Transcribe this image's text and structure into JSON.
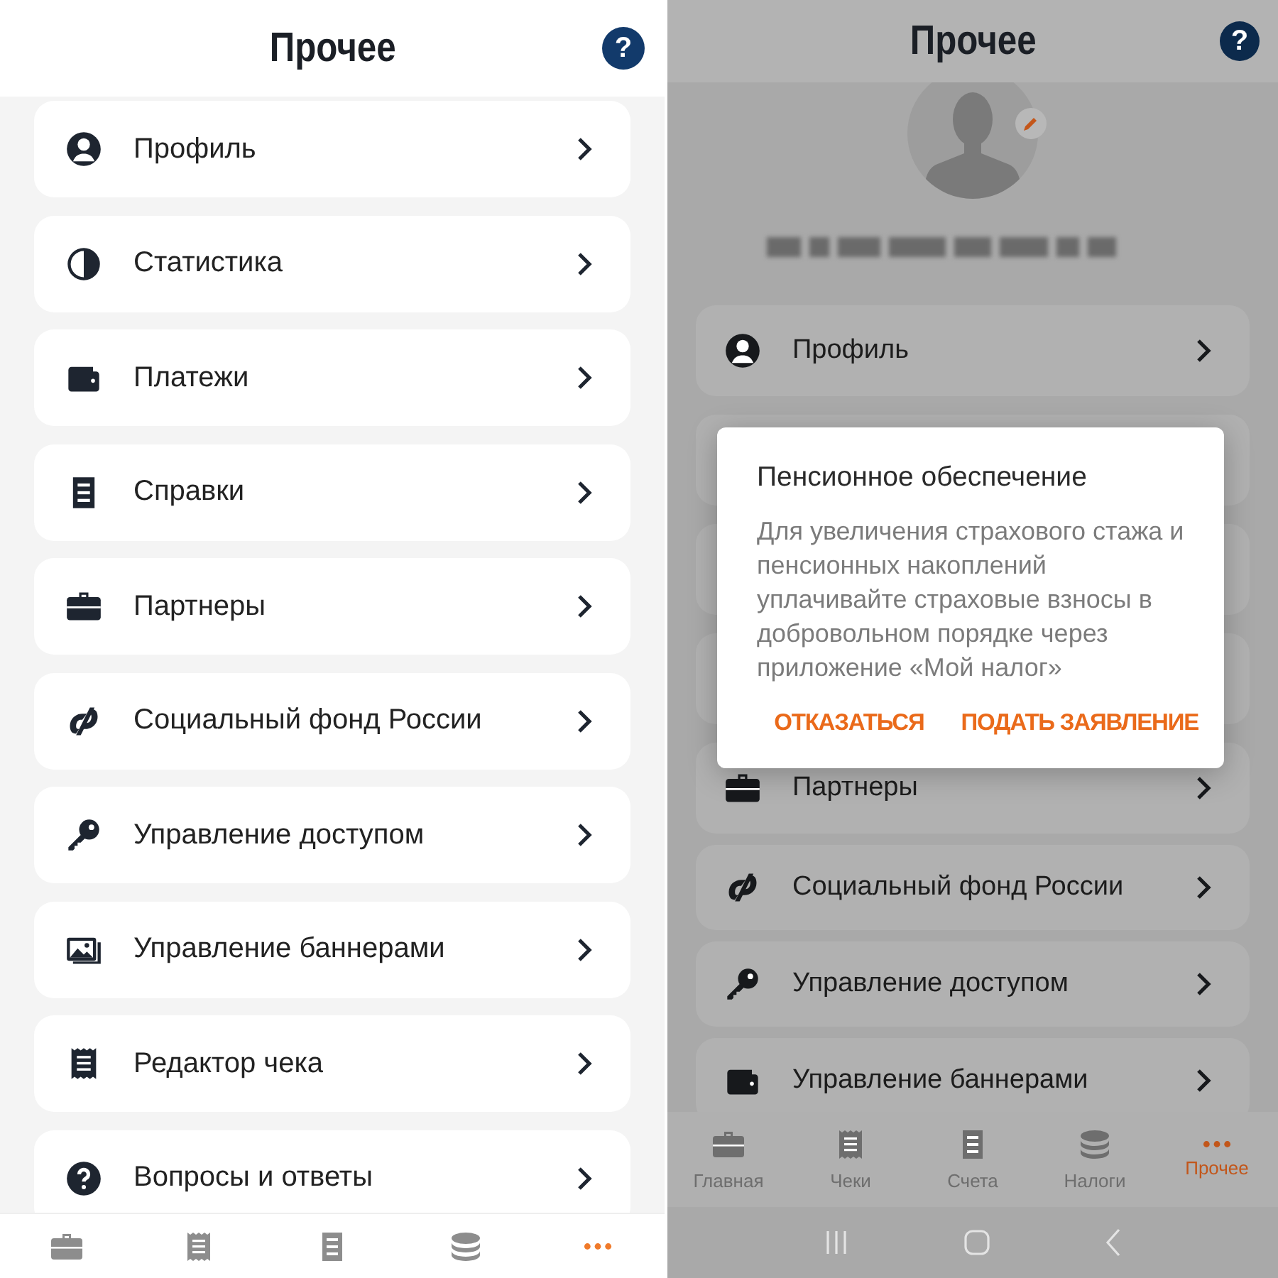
{
  "screens": [
    {
      "title": "Прочее",
      "help": "?",
      "items": [
        {
          "kind": "profile",
          "label": "Профиль"
        },
        {
          "kind": "stats",
          "label": "Статистика"
        },
        {
          "kind": "wallet",
          "label": "Платежи"
        },
        {
          "kind": "doc",
          "label": "Справки"
        },
        {
          "kind": "briefcase",
          "label": "Партнеры"
        },
        {
          "kind": "fund",
          "label": "Социальный фонд России"
        },
        {
          "kind": "key",
          "label": "Управление доступом"
        },
        {
          "kind": "image",
          "label": "Управление баннерами"
        },
        {
          "kind": "receipt",
          "label": "Редактор чека"
        },
        {
          "kind": "question",
          "label": "Вопросы и ответы"
        }
      ],
      "nav": [
        {
          "kind": "briefcase",
          "selected": false
        },
        {
          "kind": "receipt",
          "selected": false
        },
        {
          "kind": "doc",
          "selected": false
        },
        {
          "kind": "coins",
          "selected": false
        },
        {
          "kind": "more",
          "selected": true
        }
      ]
    },
    {
      "title": "Прочее",
      "help": "?",
      "items": [
        {
          "kind": "profile",
          "label": "Профиль"
        },
        {
          "kind": "briefcase",
          "label": "Партнеры"
        },
        {
          "kind": "fund",
          "label": "Социальный фонд России"
        },
        {
          "kind": "key",
          "label": "Управление доступом"
        },
        {
          "kind": "wallet",
          "label": "Управление баннерами"
        }
      ],
      "nav": [
        {
          "kind": "briefcase",
          "label": "Главная",
          "selected": false
        },
        {
          "kind": "receipt",
          "label": "Чеки",
          "selected": false
        },
        {
          "kind": "doc",
          "label": "Счета",
          "selected": false
        },
        {
          "kind": "coins",
          "label": "Налоги",
          "selected": false
        },
        {
          "kind": "more",
          "label": "Прочее",
          "selected": true
        }
      ],
      "dialog": {
        "title": "Пенсионное обеспечение",
        "text": "Для увеличения страхового стажа и пенсионных накоплений уплачивайте страховые взносы в добровольном порядке через приложение «Мой налог»",
        "buttons": [
          "ОТКАЗАТЬСЯ",
          "ПОДАТЬ ЗАЯВЛЕНИЕ"
        ]
      }
    }
  ]
}
